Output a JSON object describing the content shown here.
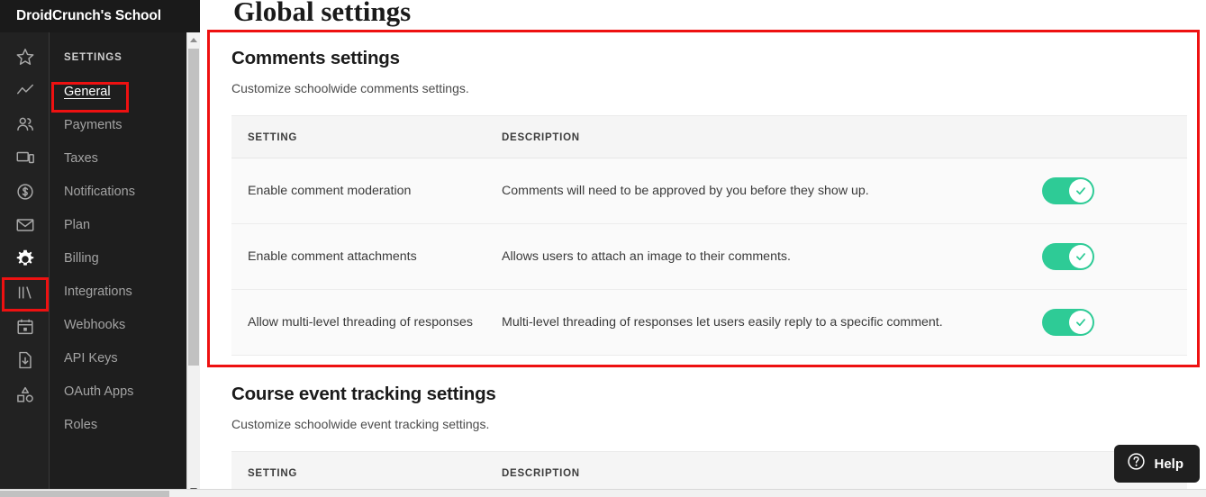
{
  "brand": {
    "title": "DroidCrunch's School"
  },
  "icon_rail": {
    "items": [
      {
        "icon": "star-icon",
        "active": false
      },
      {
        "icon": "analytics-trend-icon",
        "active": false
      },
      {
        "icon": "people-icon",
        "active": false
      },
      {
        "icon": "devices-icon",
        "active": false
      },
      {
        "icon": "dollar-circle-icon",
        "active": false
      },
      {
        "icon": "envelope-icon",
        "active": false
      },
      {
        "icon": "gear-icon",
        "active": true
      },
      {
        "icon": "books-icon",
        "active": false
      },
      {
        "icon": "calendar-icon",
        "active": false
      },
      {
        "icon": "file-download-icon",
        "active": false
      },
      {
        "icon": "shapes-icon",
        "active": false
      }
    ]
  },
  "sidebar": {
    "heading": "SETTINGS",
    "items": [
      {
        "label": "General",
        "active": true
      },
      {
        "label": "Payments",
        "active": false
      },
      {
        "label": "Taxes",
        "active": false
      },
      {
        "label": "Notifications",
        "active": false
      },
      {
        "label": "Plan",
        "active": false
      },
      {
        "label": "Billing",
        "active": false
      },
      {
        "label": "Integrations",
        "active": false
      },
      {
        "label": "Webhooks",
        "active": false
      },
      {
        "label": "API Keys",
        "active": false
      },
      {
        "label": "OAuth Apps",
        "active": false
      },
      {
        "label": "Roles",
        "active": false
      }
    ]
  },
  "page": {
    "title": "Global settings"
  },
  "comments_section": {
    "title": "Comments settings",
    "subtitle": "Customize schoolwide comments settings.",
    "columns": [
      "SETTING",
      "DESCRIPTION",
      ""
    ],
    "rows": [
      {
        "setting": "Enable comment moderation",
        "description": "Comments will need to be approved by you before they show up.",
        "toggle_on": true
      },
      {
        "setting": "Enable comment attachments",
        "description": "Allows users to attach an image to their comments.",
        "toggle_on": true
      },
      {
        "setting": "Allow multi-level threading of responses",
        "description": "Multi-level threading of responses let users easily reply to a specific comment.",
        "toggle_on": true
      }
    ]
  },
  "tracking_section": {
    "title": "Course event tracking settings",
    "subtitle": "Customize schoolwide event tracking settings.",
    "columns": [
      "SETTING",
      "DESCRIPTION",
      ""
    ]
  },
  "help": {
    "label": "Help",
    "icon": "question-circle-icon"
  },
  "colors": {
    "toggle_on": "#2ecb96",
    "annotation": "#ee1111",
    "dark_panel": "#1e1e1e",
    "rail": "#222222"
  }
}
